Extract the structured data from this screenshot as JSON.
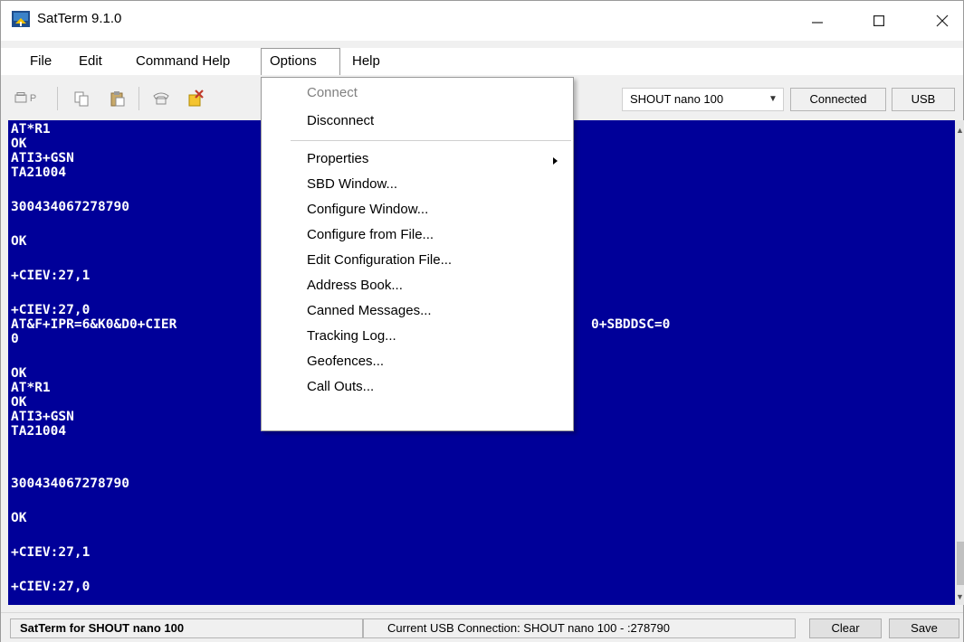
{
  "window": {
    "title": "SatTerm 9.1.0",
    "minimize_glyph": "—",
    "close_glyph": "✕"
  },
  "menubar": {
    "items": [
      "File",
      "Edit",
      "Command Help",
      "Options",
      "Help"
    ]
  },
  "toolbar": {
    "icons": [
      "print-preview-icon",
      "copy-icon",
      "paste-icon",
      "phone-icon",
      "clear-icon"
    ],
    "print_label": "P",
    "device": "SHOUT nano 100",
    "connection_status": "Connected",
    "connection_type": "USB"
  },
  "terminal": {
    "lines": [
      "AT*R1",
      "OK",
      "ATI3+GSN",
      "TA21004",
      "300434067278790",
      "OK",
      "+CIEV:27,1",
      "+CIEV:27,0",
      "AT&F+IPR=6&K0&D0+CIER",
      "0",
      "OK",
      "AT*R1",
      "OK",
      "ATI3+GSN",
      "TA21004",
      "300434067278790",
      "OK",
      "+CIEV:27,1",
      "+CIEV:27,0"
    ],
    "partial_line_tail": "0+SBDDSC=0",
    "background": "#000099",
    "text_color": "#ffffff"
  },
  "options_menu": {
    "items": [
      {
        "label": "Connect",
        "enabled": false
      },
      {
        "label": "Disconnect",
        "enabled": true
      },
      {
        "label": "Properties",
        "enabled": true,
        "submenu": true
      },
      {
        "label": "SBD Window...",
        "enabled": true
      },
      {
        "label": "Configure Window...",
        "enabled": true
      },
      {
        "label": "Configure from File...",
        "enabled": true
      },
      {
        "label": "Edit Configuration File...",
        "enabled": true
      },
      {
        "label": "Address Book...",
        "enabled": true
      },
      {
        "label": "Canned Messages...",
        "enabled": true
      },
      {
        "label": "Tracking Log...",
        "enabled": true
      },
      {
        "label": "Geofences...",
        "enabled": true
      },
      {
        "label": "Call Outs...",
        "enabled": true
      }
    ]
  },
  "statusbar": {
    "left": "SatTerm for SHOUT nano 100",
    "middle": "Current USB Connection: SHOUT nano 100 - :278790",
    "clear_label": "Clear",
    "save_label": "Save"
  }
}
